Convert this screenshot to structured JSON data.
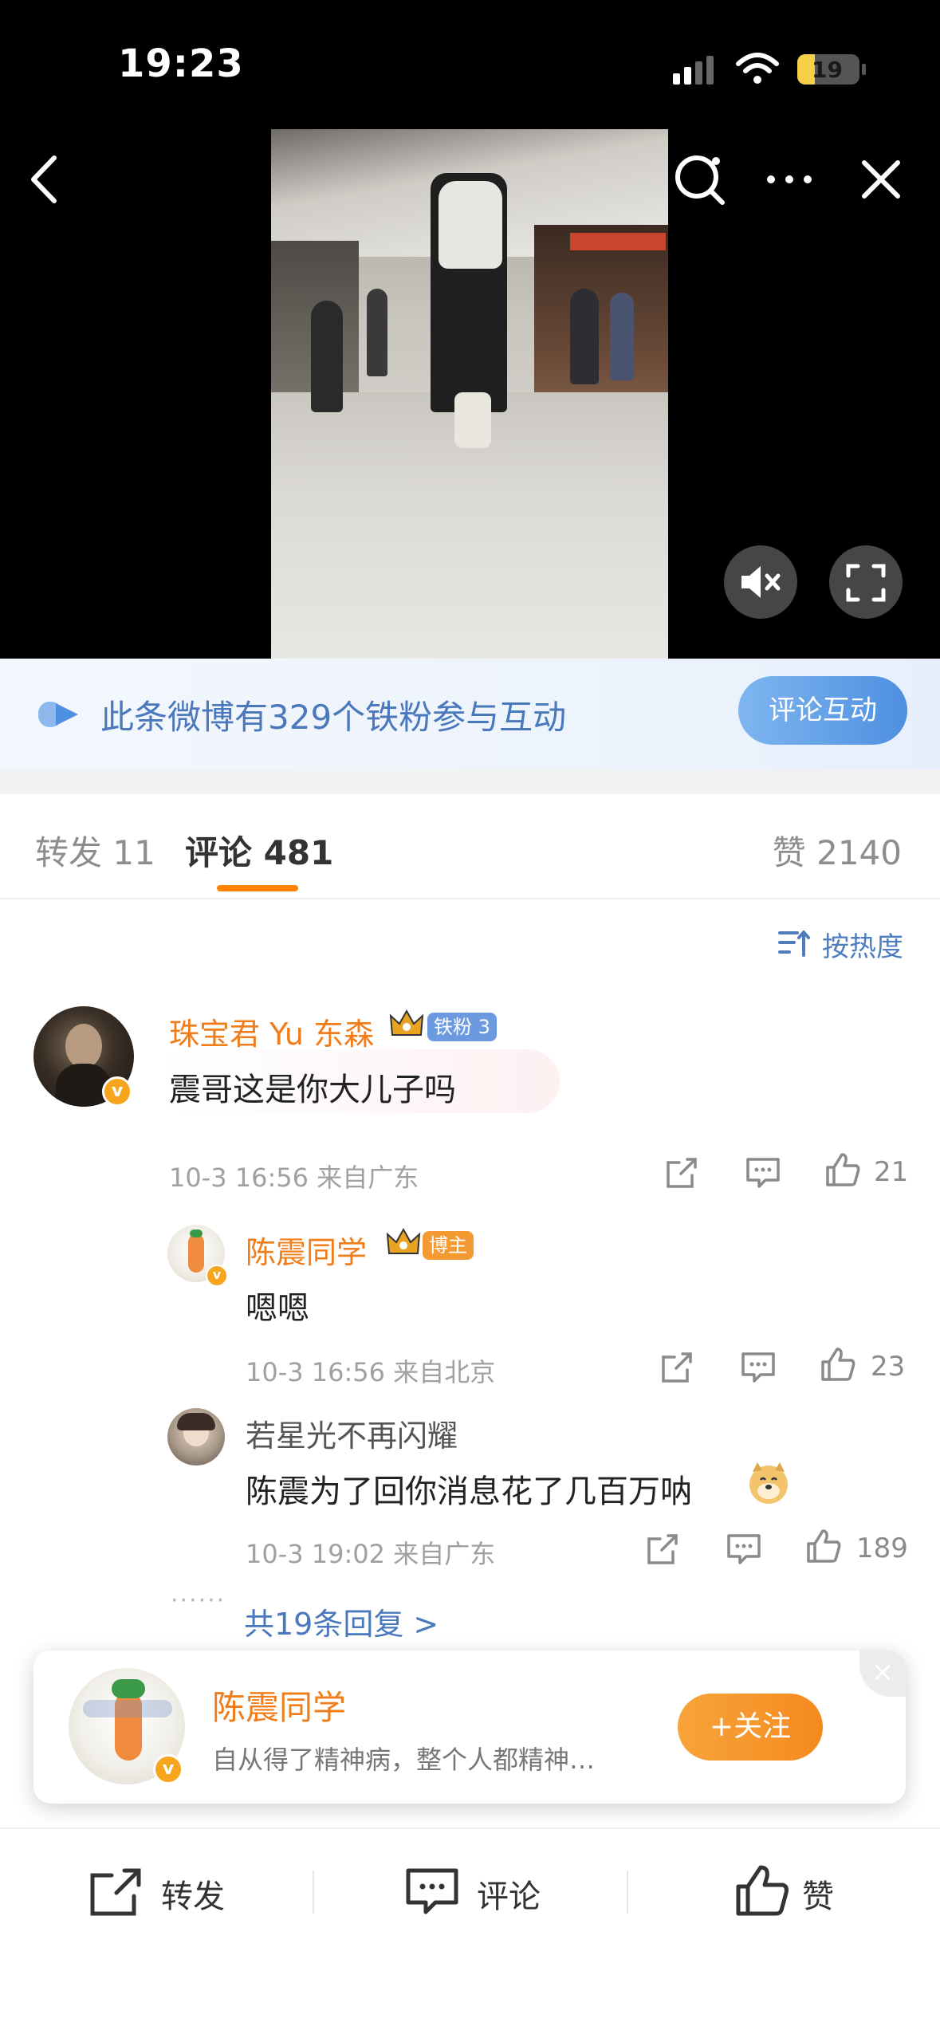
{
  "status_bar": {
    "time": "19:23",
    "battery": "19"
  },
  "video": {
    "mute_label": "mute",
    "fullscreen_label": "fullscreen"
  },
  "fan_banner": {
    "text": "此条微博有329个铁粉参与互动",
    "button": "评论互动"
  },
  "tabs": {
    "repost": "转发 11",
    "comment": "评论 481",
    "like": "赞 2140"
  },
  "sort": {
    "label": "按热度"
  },
  "comments": [
    {
      "user": "珠宝君 Yu 东森",
      "badge": "铁粉 3",
      "text": "震哥这是你大儿子吗",
      "time": "10-3 16:56 来自广东",
      "likes": "21",
      "replies": [
        {
          "user": "陈震同学",
          "badge": "博主",
          "text": "嗯嗯",
          "time": "10-3 16:56 来自北京",
          "likes": "23"
        },
        {
          "user": "若星光不再闪耀",
          "text": "陈震为了回你消息花了几百万呐",
          "time": "10-3 19:02 来自广东",
          "likes": "189"
        }
      ],
      "more_replies": "共19条回复 >"
    }
  ],
  "follow_card": {
    "name": "陈震同学",
    "bio": "自从得了精神病，整个人都精神…",
    "button": "+关注",
    "close": "×"
  },
  "bottom_bar": {
    "repost": "转发",
    "comment": "评论",
    "like": "赞"
  },
  "colors": {
    "accent": "#ff8200",
    "link": "#4a78bd",
    "username": "#f07c1a"
  }
}
